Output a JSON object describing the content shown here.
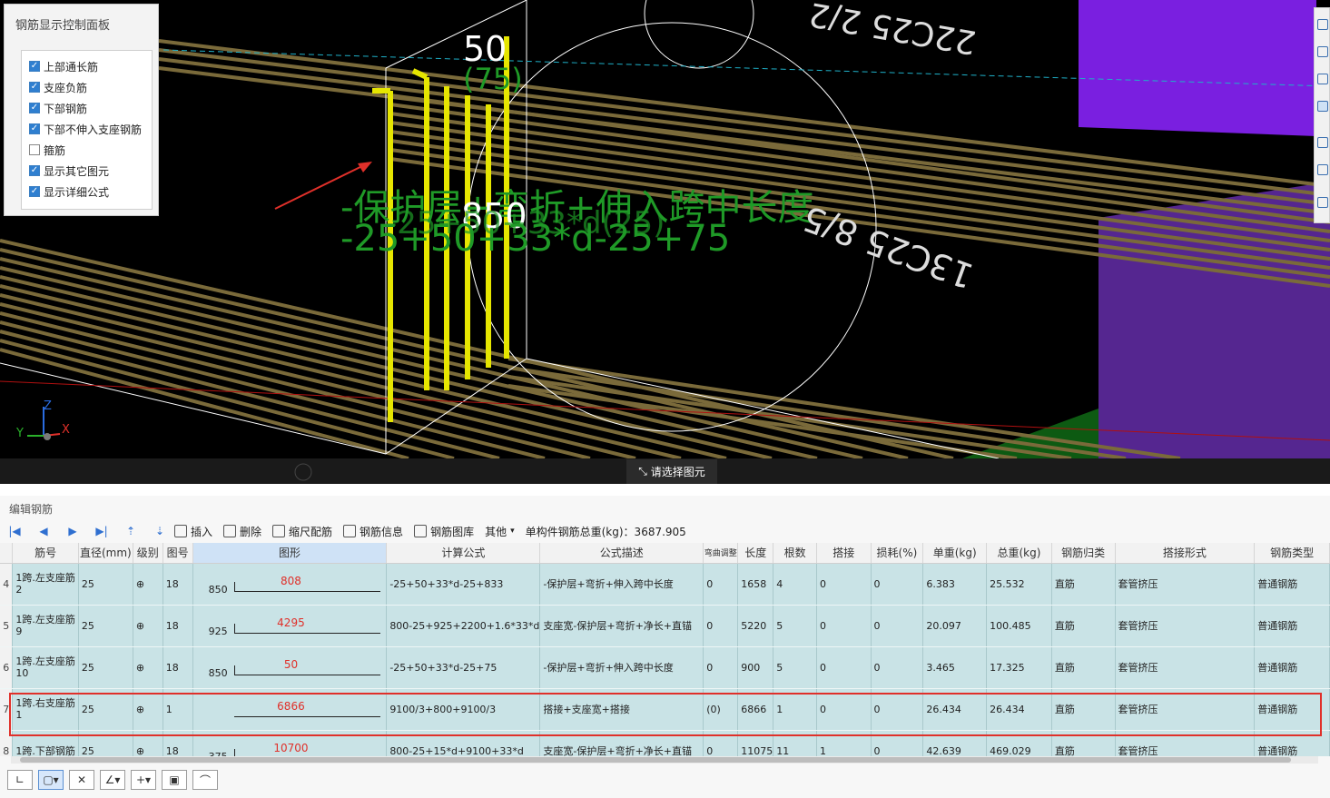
{
  "control_panel": {
    "title": "钢筋显示控制面板",
    "options": [
      {
        "label": "上部通长筋",
        "checked": true
      },
      {
        "label": "支座负筋",
        "checked": true
      },
      {
        "label": "下部钢筋",
        "checked": true
      },
      {
        "label": "下部不伸入支座钢筋",
        "checked": true
      },
      {
        "label": "箍筋",
        "checked": false
      },
      {
        "label": "显示其它图元",
        "checked": true
      },
      {
        "label": "显示详细公式",
        "checked": true
      }
    ]
  },
  "viewport": {
    "dim_50": "50",
    "dim_75": "(75)",
    "dim_850": "850",
    "formula_desc": "-保护层+弯折+伸入跨中长度",
    "formula_calc": "-25+50+33*d-25+75",
    "formula_overlap": "-25+50+33*d(25)",
    "label_top": "22C25 2/2",
    "label_mid": "13C25 8/5",
    "axis_x": "X",
    "axis_y": "Y",
    "axis_z": "Z",
    "status": "请选择图元"
  },
  "editor": {
    "title": "编辑钢筋",
    "toolbar": {
      "insert": "插入",
      "delete": "删除",
      "scale": "缩尺配筋",
      "info": "钢筋信息",
      "library": "钢筋图库",
      "other": "其他",
      "total_weight": "单构件钢筋总重(kg)：3687.905"
    },
    "columns": [
      "筋号",
      "直径(mm)",
      "级别",
      "图号",
      "图形",
      "计算公式",
      "公式描述",
      "弯曲调整",
      "长度",
      "根数",
      "搭接",
      "损耗(%)",
      "单重(kg)",
      "总重(kg)",
      "钢筋归类",
      "搭接形式",
      "钢筋类型"
    ],
    "rows": [
      {
        "idx": "4",
        "name": "1跨.左支座筋2",
        "dia": "25",
        "grade": "⊕",
        "fig": "18",
        "shape_left": "850",
        "shape_val": "808",
        "formula": "-25+50+33*d-25+833",
        "desc": "-保护层+弯折+伸入跨中长度",
        "bend": "0",
        "length": "1658",
        "count": "4",
        "lap": "0",
        "loss": "0",
        "unit_w": "6.383",
        "total_w": "25.532",
        "category": "直筋",
        "lap_type": "套管挤压",
        "type": "普通钢筋"
      },
      {
        "idx": "5",
        "name": "1跨.左支座筋9",
        "dia": "25",
        "grade": "⊕",
        "fig": "18",
        "shape_left": "925",
        "shape_val": "4295",
        "formula": "800-25+925+2200+1.6*33*d",
        "desc": "支座宽-保护层+弯折+净长+直锚",
        "bend": "0",
        "length": "5220",
        "count": "5",
        "lap": "0",
        "loss": "0",
        "unit_w": "20.097",
        "total_w": "100.485",
        "category": "直筋",
        "lap_type": "套管挤压",
        "type": "普通钢筋"
      },
      {
        "idx": "6",
        "name": "1跨.左支座筋10",
        "dia": "25",
        "grade": "⊕",
        "fig": "18",
        "shape_left": "850",
        "shape_val": "50",
        "formula": "-25+50+33*d-25+75",
        "desc": "-保护层+弯折+伸入跨中长度",
        "bend": "0",
        "length": "900",
        "count": "5",
        "lap": "0",
        "loss": "0",
        "unit_w": "3.465",
        "total_w": "17.325",
        "category": "直筋",
        "lap_type": "套管挤压",
        "type": "普通钢筋"
      },
      {
        "idx": "7",
        "name": "1跨.右支座筋1",
        "dia": "25",
        "grade": "⊕",
        "fig": "1",
        "shape_left": "",
        "shape_val": "6866",
        "formula": "9100/3+800+9100/3",
        "desc": "搭接+支座宽+搭接",
        "bend": "(0)",
        "length": "6866",
        "count": "1",
        "lap": "0",
        "loss": "0",
        "unit_w": "26.434",
        "total_w": "26.434",
        "category": "直筋",
        "lap_type": "套管挤压",
        "type": "普通钢筋"
      },
      {
        "idx": "8",
        "name": "1跨.下部钢筋",
        "dia": "25",
        "grade": "⊕",
        "fig": "18",
        "shape_left": "375",
        "shape_val": "10700",
        "formula": "800-25+15*d+9100+33*d",
        "desc": "支座宽-保护层+弯折+净长+直锚",
        "bend": "0",
        "length": "11075",
        "count": "11",
        "lap": "1",
        "loss": "0",
        "unit_w": "42.639",
        "total_w": "469.029",
        "category": "直筋",
        "lap_type": "套管挤压",
        "type": "普通钢筋"
      }
    ]
  },
  "colors": {
    "accent": "#2f7fd0",
    "highlight": "#e0302a",
    "rebar": "#e6e600",
    "grid_bg": "#c9e3e6"
  }
}
